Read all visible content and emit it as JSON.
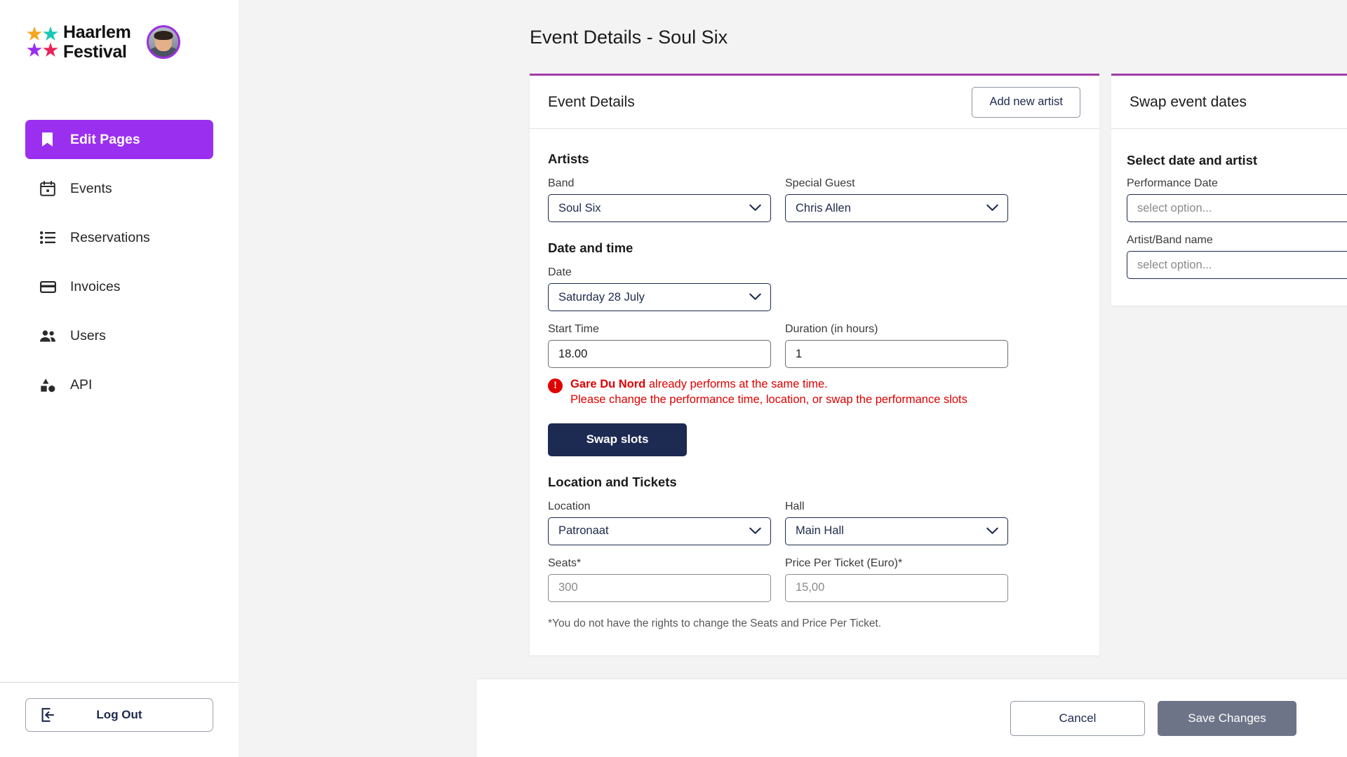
{
  "brand": {
    "line1": "Haarlem",
    "line2": "Festival",
    "star_colors": [
      "#F5A623",
      "#19C8B4",
      "#9B2FF0",
      "#E8245B"
    ],
    "avatar_ring_color": "#9B30E0"
  },
  "sidebar": {
    "items": [
      {
        "label": "Edit Pages",
        "icon": "bookmark-icon",
        "active": true
      },
      {
        "label": "Events",
        "icon": "calendar-icon",
        "active": false
      },
      {
        "label": "Reservations",
        "icon": "list-icon",
        "active": false
      },
      {
        "label": "Invoices",
        "icon": "credit-card-icon",
        "active": false
      },
      {
        "label": "Users",
        "icon": "users-icon",
        "active": false
      },
      {
        "label": "API",
        "icon": "shapes-icon",
        "active": false
      }
    ],
    "logout_label": "Log Out",
    "logout_icon": "logout-icon",
    "active_color": "#9B2FF0"
  },
  "page": {
    "title": "Event Details - Soul Six",
    "accent_color": "#A13CA8"
  },
  "left_panel": {
    "title": "Event Details",
    "add_artist_label": "Add new artist",
    "artists": {
      "section_title": "Artists",
      "band_label": "Band",
      "band_value": "Soul Six",
      "guest_label": "Special Guest",
      "guest_value": "Chris Allen"
    },
    "date_time": {
      "section_title": "Date and time",
      "date_label": "Date",
      "date_value": "Saturday 28 July",
      "start_time_label": "Start Time",
      "start_time_value": "18.00",
      "duration_label": "Duration (in hours)",
      "duration_value": "1"
    },
    "error": {
      "icon": "error-exclamation-icon",
      "artist": "Gare Du Nord",
      "line1_rest": " already performs at the same time.",
      "line2": "Please change the performance time, location, or swap the performance slots",
      "color": "#E00000"
    },
    "swap_slots_label": "Swap slots",
    "location": {
      "section_title": "Location and Tickets",
      "location_label": "Location",
      "location_value": "Patronaat",
      "hall_label": "Hall",
      "hall_value": "Main Hall",
      "seats_label": "Seats*",
      "seats_value": "300",
      "price_label": "Price Per Ticket (Euro)*",
      "price_value": "15,00"
    },
    "footnote": "*You do not have the rights to change the Seats and Price Per Ticket."
  },
  "right_panel": {
    "title": "Swap event dates",
    "section_title": "Select date and artist",
    "performance_date_label": "Performance Date",
    "performance_date_value": "select option...",
    "artist_band_label": "Artist/Band name",
    "artist_band_value": "select option..."
  },
  "footer": {
    "cancel_label": "Cancel",
    "save_label": "Save Changes",
    "save_disabled_color": "#6D7488"
  }
}
